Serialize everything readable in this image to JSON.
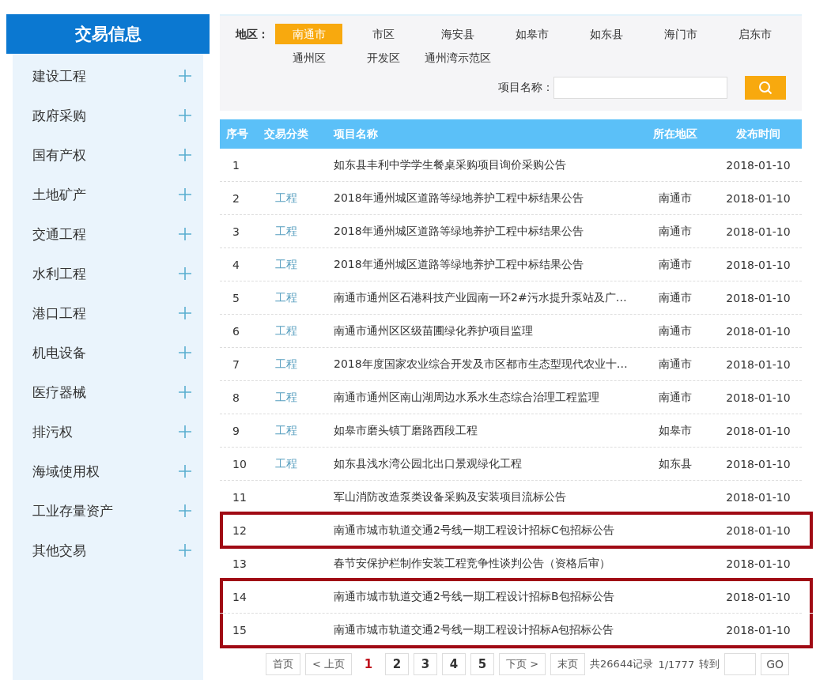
{
  "sidebar": {
    "title": "交易信息",
    "items": [
      {
        "label": "建设工程"
      },
      {
        "label": "政府采购"
      },
      {
        "label": "国有产权"
      },
      {
        "label": "土地矿产"
      },
      {
        "label": "交通工程"
      },
      {
        "label": "水利工程"
      },
      {
        "label": "港口工程"
      },
      {
        "label": "机电设备"
      },
      {
        "label": "医疗器械"
      },
      {
        "label": "排污权"
      },
      {
        "label": "海域使用权"
      },
      {
        "label": "工业存量资产"
      },
      {
        "label": "其他交易"
      }
    ]
  },
  "filter": {
    "region_label": "地区：",
    "regions": [
      {
        "label": "南通市",
        "selected": true
      },
      {
        "label": "市区",
        "selected": false
      },
      {
        "label": "海安县",
        "selected": false
      },
      {
        "label": "如皋市",
        "selected": false
      },
      {
        "label": "如东县",
        "selected": false
      },
      {
        "label": "海门市",
        "selected": false
      },
      {
        "label": "启东市",
        "selected": false
      },
      {
        "label": "通州区",
        "selected": false
      },
      {
        "label": "开发区",
        "selected": false
      },
      {
        "label": "通州湾示范区",
        "selected": false
      }
    ],
    "search_label": "项目名称："
  },
  "table": {
    "columns": [
      "序号",
      "交易分类",
      "项目名称",
      "所在地区",
      "发布时间"
    ],
    "rows": [
      {
        "no": "1",
        "category": "",
        "title": "如东县丰利中学学生餐桌采购项目询价采购公告",
        "region": "",
        "date": "2018-01-10",
        "highlighted": false
      },
      {
        "no": "2",
        "category": "工程",
        "title": "2018年通州城区道路等绿地养护工程中标结果公告",
        "region": "南通市",
        "date": "2018-01-10",
        "highlighted": false
      },
      {
        "no": "3",
        "category": "工程",
        "title": "2018年通州城区道路等绿地养护工程中标结果公告",
        "region": "南通市",
        "date": "2018-01-10",
        "highlighted": false
      },
      {
        "no": "4",
        "category": "工程",
        "title": "2018年通州城区道路等绿地养护工程中标结果公告",
        "region": "南通市",
        "date": "2018-01-10",
        "highlighted": false
      },
      {
        "no": "5",
        "category": "工程",
        "title": "南通市通州区石港科技产业园南一环2#污水提升泵站及广…",
        "region": "南通市",
        "date": "2018-01-10",
        "highlighted": false
      },
      {
        "no": "6",
        "category": "工程",
        "title": "南通市通州区区级苗圃绿化养护项目监理",
        "region": "南通市",
        "date": "2018-01-10",
        "highlighted": false
      },
      {
        "no": "7",
        "category": "工程",
        "title": "2018年度国家农业综合开发及市区都市生态型现代农业十…",
        "region": "南通市",
        "date": "2018-01-10",
        "highlighted": false
      },
      {
        "no": "8",
        "category": "工程",
        "title": "南通市通州区南山湖周边水系水生态综合治理工程监理",
        "region": "南通市",
        "date": "2018-01-10",
        "highlighted": false
      },
      {
        "no": "9",
        "category": "工程",
        "title": "如皋市磨头镇丁磨路西段工程",
        "region": "如皋市",
        "date": "2018-01-10",
        "highlighted": false
      },
      {
        "no": "10",
        "category": "工程",
        "title": "如东县浅水湾公园北出口景观绿化工程",
        "region": "如东县",
        "date": "2018-01-10",
        "highlighted": false
      },
      {
        "no": "11",
        "category": "",
        "title": "军山消防改造泵类设备采购及安装项目流标公告",
        "region": "",
        "date": "2018-01-10",
        "highlighted": false
      },
      {
        "no": "12",
        "category": "",
        "title": "南通市城市轨道交通2号线一期工程设计招标C包招标公告",
        "region": "",
        "date": "2018-01-10",
        "highlighted": true
      },
      {
        "no": "13",
        "category": "",
        "title": "春节安保护栏制作安装工程竞争性谈判公告（资格后审）",
        "region": "",
        "date": "2018-01-10",
        "highlighted": false
      },
      {
        "no": "14",
        "category": "",
        "title": "南通市城市轨道交通2号线一期工程设计招标B包招标公告",
        "region": "",
        "date": "2018-01-10",
        "highlighted": true
      },
      {
        "no": "15",
        "category": "",
        "title": "南通市城市轨道交通2号线一期工程设计招标A包招标公告",
        "region": "",
        "date": "2018-01-10",
        "highlighted": true
      }
    ]
  },
  "pagination": {
    "first": "首页",
    "prev": "< 上页",
    "pages": [
      {
        "label": "1",
        "selected": true
      },
      {
        "label": "2",
        "selected": false
      },
      {
        "label": "3",
        "selected": false
      },
      {
        "label": "4",
        "selected": false
      },
      {
        "label": "5",
        "selected": false
      }
    ],
    "next": "下页 >",
    "last": "末页",
    "total": "共26644记录",
    "page_info": "1/1777",
    "goto_label": "转到",
    "go": "GO"
  }
}
